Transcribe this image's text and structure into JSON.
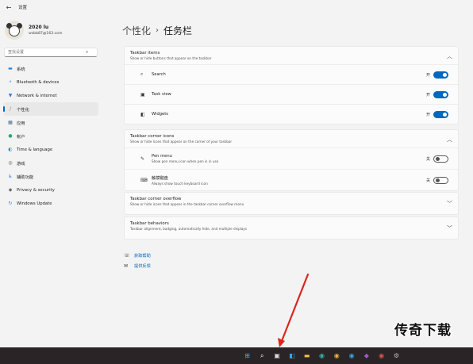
{
  "window": {
    "title": "设置",
    "back_glyph": "←"
  },
  "user": {
    "name": "2020 lu",
    "email": "wsbb87@163.com"
  },
  "search": {
    "placeholder": "查找设置",
    "icon": "search-icon"
  },
  "sidebar": {
    "items": [
      {
        "label": "系统",
        "icon": "monitor-icon",
        "color": "#2f7fd8",
        "glyph": "▬",
        "active": false
      },
      {
        "label": "Bluetooth & devices",
        "icon": "bluetooth-icon",
        "color": "#2f7fd8",
        "glyph": "⚡",
        "active": false
      },
      {
        "label": "Network & internet",
        "icon": "wifi-icon",
        "color": "#2f7fd8",
        "glyph": "▼",
        "active": false
      },
      {
        "label": "个性化",
        "icon": "brush-icon",
        "color": "#c06a2b",
        "glyph": "/",
        "active": true
      },
      {
        "label": "应用",
        "icon": "apps-icon",
        "color": "#4a6b8a",
        "glyph": "▦",
        "active": false
      },
      {
        "label": "帐户",
        "icon": "account-icon",
        "color": "#2ea86b",
        "glyph": "●",
        "active": false
      },
      {
        "label": "Time & language",
        "icon": "globe-icon",
        "color": "#2f7fd8",
        "glyph": "◐",
        "active": false
      },
      {
        "label": "游戏",
        "icon": "gamepad-icon",
        "color": "#555555",
        "glyph": "◎",
        "active": false
      },
      {
        "label": "辅助功能",
        "icon": "accessibility-icon",
        "color": "#2f7fd8",
        "glyph": "♿",
        "active": false
      },
      {
        "label": "Privacy & security",
        "icon": "shield-icon",
        "color": "#6b6b6b",
        "glyph": "◆",
        "active": false
      },
      {
        "label": "Windows Update",
        "icon": "update-icon",
        "color": "#2f7fd8",
        "glyph": "↻",
        "active": false
      }
    ]
  },
  "breadcrumb": {
    "parent": "个性化",
    "separator": "›",
    "current": "任务栏"
  },
  "sections": {
    "taskbar_items": {
      "title": "Taskbar items",
      "subtitle": "Show or hide buttons that appear on the taskbar",
      "expanded": true,
      "rows": [
        {
          "label": "Search",
          "icon": "search-icon",
          "glyph": "⌕",
          "state_label": "开",
          "on": true
        },
        {
          "label": "Task view",
          "icon": "task-view-icon",
          "glyph": "▣",
          "state_label": "开",
          "on": true
        },
        {
          "label": "Widgets",
          "icon": "widgets-icon",
          "glyph": "◧",
          "state_label": "开",
          "on": true
        }
      ]
    },
    "corner_icons": {
      "title": "Taskbar corner icons",
      "subtitle": "Show or hide icons that appear on the corner of your taskbar",
      "expanded": true,
      "rows": [
        {
          "label": "Pen menu",
          "subtitle": "Show pen menu icon when pen is in use",
          "icon": "pen-icon",
          "glyph": "✎",
          "state_label": "关",
          "on": false
        },
        {
          "label": "触摸键盘",
          "subtitle": "Always show touch keyboard icon",
          "icon": "keyboard-icon",
          "glyph": "⌨",
          "state_label": "关",
          "on": false
        }
      ]
    },
    "corner_overflow": {
      "title": "Taskbar corner overflow",
      "subtitle": "Show or hide icons that appear in the taskbar corner overflow menu",
      "expanded": false
    },
    "behaviors": {
      "title": "Taskbar behaviors",
      "subtitle": "Taskbar alignment, badging, automatically hide, and multiple displays",
      "expanded": false
    }
  },
  "links": [
    {
      "label": "获取帮助",
      "icon": "help-icon",
      "glyph": "☏"
    },
    {
      "label": "提供反馈",
      "icon": "feedback-icon",
      "glyph": "✉"
    }
  ],
  "watermark": "传奇下载",
  "taskbar": {
    "background": "#2b2426",
    "icons": [
      {
        "name": "start-icon",
        "color": "#4aa3ff",
        "glyph": "⊞"
      },
      {
        "name": "search-icon",
        "color": "#ffffff",
        "glyph": "⌕"
      },
      {
        "name": "task-view-icon",
        "color": "#dddddd",
        "glyph": "▣"
      },
      {
        "name": "widgets-icon",
        "color": "#3aa0e8",
        "glyph": "◧"
      },
      {
        "name": "file-explorer-icon",
        "color": "#f2c14e",
        "glyph": "▬"
      },
      {
        "name": "edge-icon",
        "color": "#30b3a8",
        "glyph": "◉"
      },
      {
        "name": "chrome-icon",
        "color": "#e8b33b",
        "glyph": "◉"
      },
      {
        "name": "browser-icon",
        "color": "#33a3dc",
        "glyph": "◉"
      },
      {
        "name": "app-icon",
        "color": "#9b59d0",
        "glyph": "◆"
      },
      {
        "name": "game-icon",
        "color": "#d9534f",
        "glyph": "◉"
      },
      {
        "name": "settings-icon",
        "color": "#bbbbbb",
        "glyph": "⚙"
      }
    ]
  }
}
